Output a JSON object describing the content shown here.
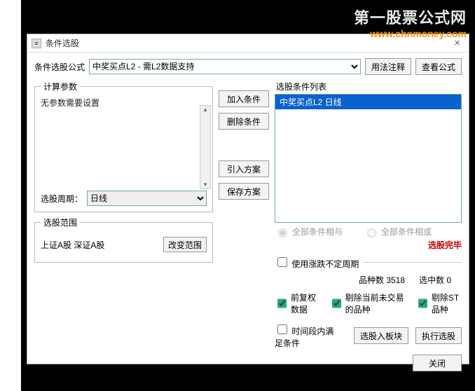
{
  "watermark": {
    "line1": "第一股票公式网",
    "line2": "www.chnmoney.com"
  },
  "window": {
    "title": "条件选股"
  },
  "formulaRow": {
    "label": "条件选股公式",
    "selected": "中奖买点L2  - 需L2数据支持",
    "usageBtn": "用法注释",
    "viewBtn": "查看公式"
  },
  "params": {
    "legend": "计算参数",
    "noParams": "无参数需要设置",
    "periodLabel": "选股周期：",
    "periodValue": "日线"
  },
  "range": {
    "legend": "选股范围",
    "text": "上证A股 深证A股",
    "changeBtn": "改变范围"
  },
  "midButtons": {
    "add": "加入条件",
    "del": "删除条件",
    "import": "引入方案",
    "save": "保存方案"
  },
  "condList": {
    "label": "选股条件列表",
    "item": "中奖买点L2   日线"
  },
  "logic": {
    "and": "全部条件相与",
    "or": "全部条件相或"
  },
  "status": "选股完毕",
  "periodCheck": "使用涨跌不定周期",
  "counts": {
    "totalLabel": "品种数",
    "totalValue": "3518",
    "selLabel": "选中数",
    "selValue": "0"
  },
  "checks": {
    "fq": "前复权数据",
    "ex1": "剔除当前未交易的品种",
    "ex2": "剔除ST品种"
  },
  "timeCheck": "时间段内满足条件",
  "actions": {
    "toBlock": "选股入板块",
    "exec": "执行选股",
    "close": "关闭"
  }
}
